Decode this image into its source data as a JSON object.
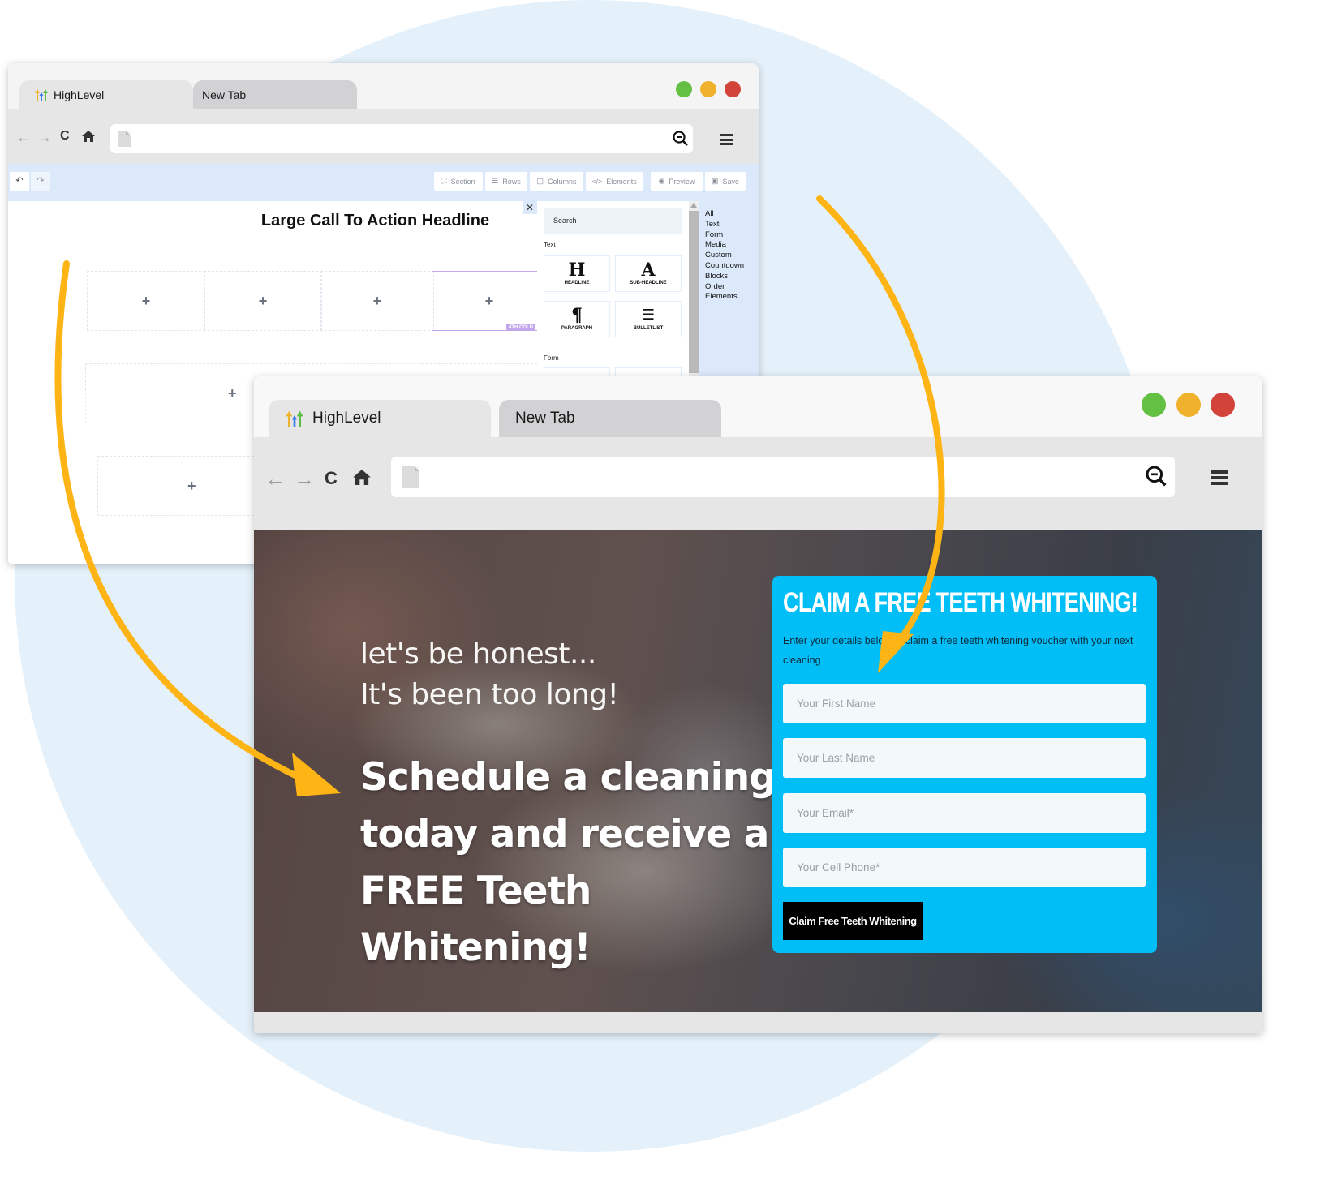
{
  "colors": {
    "background_circle": "#e5f1fa",
    "traffic_green": "#64c043",
    "traffic_yellow": "#f0b22d",
    "traffic_red": "#d2433a",
    "builder_accent": "#dbe9fb",
    "selected_column": "#c3a7ec",
    "form_panel": "#01bff6",
    "arrow": "#fdb414"
  },
  "back_window": {
    "tabs": [
      {
        "label": "HighLevel",
        "icon": "highlevel-logo-icon",
        "active": true
      },
      {
        "label": "New Tab",
        "active": false
      }
    ],
    "toolbar": {
      "back_icon": "arrow-left-icon",
      "forward_icon": "arrow-right-icon",
      "reload_icon": "reload-icon",
      "home_icon": "home-icon",
      "url_value": "",
      "zoom_icon": "zoom-out-icon",
      "menu_icon": "hamburger-menu-icon"
    },
    "builder_bar": {
      "undo_icon": "undo-icon",
      "redo_icon": "redo-icon",
      "buttons": [
        {
          "label": "Section",
          "icon": "section-icon"
        },
        {
          "label": "Rows",
          "icon": "rows-icon"
        },
        {
          "label": "Columns",
          "icon": "columns-icon"
        },
        {
          "label": "Elements",
          "icon": "code-icon"
        },
        {
          "label": "Preview",
          "icon": "eye-icon"
        },
        {
          "label": "Save",
          "icon": "save-icon"
        }
      ]
    },
    "canvas": {
      "headline": "Large Call To Action Headline",
      "add_symbol": "+",
      "selected_column_badge": "4TH COLU"
    },
    "elements_panel": {
      "close_symbol": "✕",
      "search_placeholder": "Search",
      "sections": [
        {
          "title": "Text",
          "items": [
            {
              "glyph": "H",
              "label": "HEADLINE"
            },
            {
              "glyph": "A",
              "label": "SUB-HEADLINE"
            },
            {
              "glyph": "¶",
              "label": "PARAGRAPH"
            },
            {
              "glyph": "☰",
              "label": "BULLETLIST"
            }
          ]
        },
        {
          "title": "Form",
          "items": []
        }
      ],
      "categories": [
        "All",
        "Text",
        "Form",
        "Media",
        "Custom",
        "Countdown",
        "Blocks",
        "Order",
        "Elements"
      ]
    }
  },
  "front_window": {
    "tabs": [
      {
        "label": "HighLevel",
        "icon": "highlevel-logo-icon",
        "active": true
      },
      {
        "label": "New Tab",
        "active": false
      }
    ],
    "toolbar": {
      "url_value": ""
    },
    "hero": {
      "intro_line_1": "let's be honest...",
      "intro_line_2": "It's been too long!",
      "headline": "Schedule a cleaning today and receive a FREE Teeth Whitening!"
    },
    "form": {
      "title": "CLAIM A FREE TEETH WHITENING!",
      "subtitle": "Enter your details below to claim a free teeth whitening voucher with your next cleaning",
      "fields": [
        {
          "name": "first-name",
          "placeholder": "Your First Name",
          "value": ""
        },
        {
          "name": "last-name",
          "placeholder": "Your Last Name",
          "value": ""
        },
        {
          "name": "email",
          "placeholder": "Your Email*",
          "value": ""
        },
        {
          "name": "cell-phone",
          "placeholder": "Your Cell Phone*",
          "value": ""
        }
      ],
      "submit_label": "Claim Free Teeth Whitening"
    }
  }
}
